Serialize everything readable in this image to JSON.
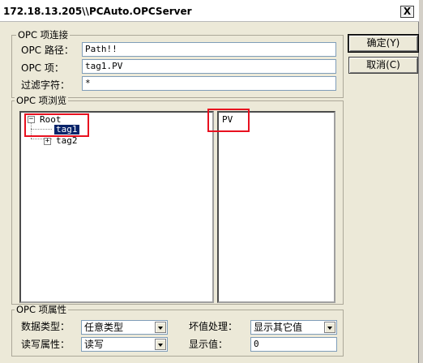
{
  "window": {
    "title": "172.18.13.205\\\\PCAuto.OPCServer",
    "close_symbol": "X"
  },
  "buttons": {
    "ok": "确定(Y)",
    "cancel": "取消(C)"
  },
  "connection_group": {
    "title": "OPC 项连接",
    "path_label": "OPC 路径：",
    "path_value": "Path!!",
    "item_label": "OPC 项：",
    "item_value": "tag1.PV",
    "filter_label": "过滤字符：",
    "filter_value": "*"
  },
  "browse_group": {
    "title": "OPC 项浏览",
    "tree": {
      "root": {
        "label": "Root",
        "expander": "−"
      },
      "children": [
        {
          "label": "tag1",
          "selected": true
        },
        {
          "label": "tag2",
          "expander": "+"
        }
      ]
    },
    "properties": [
      "PV"
    ]
  },
  "attributes_group": {
    "title": "OPC 项属性",
    "datatype_label": "数据类型：",
    "datatype_value": "任意类型",
    "access_label": "读写属性：",
    "access_value": "读写",
    "badvalue_label": "坏值处理：",
    "badvalue_value": "显示其它值",
    "display_label": "显示值：",
    "display_value": "0"
  },
  "colors": {
    "highlight_box": "#e8101f",
    "selection": "#0a246a",
    "dialog_bg": "#ece9d8"
  }
}
